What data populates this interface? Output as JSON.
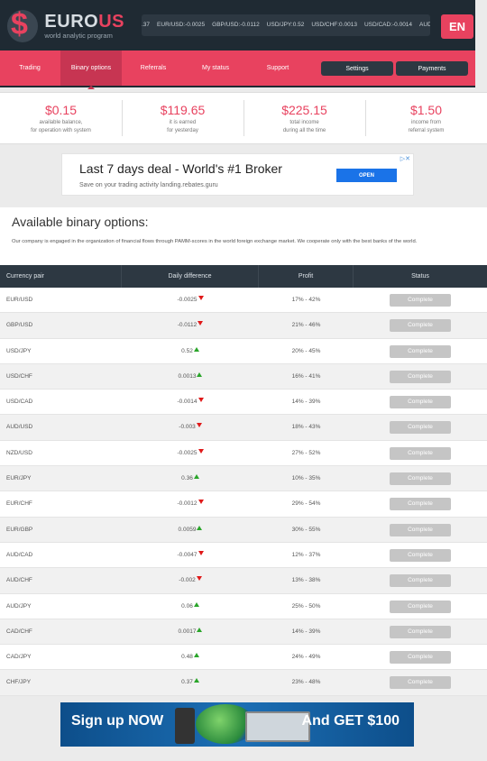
{
  "header": {
    "brand_a": "EURO",
    "brand_b": "US",
    "tagline": "world analytic program",
    "logo_glyph": "$",
    "ticker": [
      ".37",
      "EUR/USD:-0.0025",
      "GBP/USD:-0.0112",
      "USD/JPY:0.52",
      "USD/CHF:0.0013",
      "USD/CAD:-0.0014",
      "AUD/USD:-0"
    ],
    "lang": "EN"
  },
  "nav": {
    "items": [
      "Trading",
      "Binary options",
      "Referrals",
      "My status",
      "Support"
    ],
    "active": "Binary options",
    "settings": "Settings",
    "payments": "Payments"
  },
  "stats": [
    {
      "value": "$0.15",
      "l1": "available balance,",
      "l2": "for operation with system"
    },
    {
      "value": "$119.65",
      "l1": "it is earned",
      "l2": "for yesterday"
    },
    {
      "value": "$225.15",
      "l1": "total income",
      "l2": "during all the time"
    },
    {
      "value": "$1.50",
      "l1": "income from",
      "l2": "referral system"
    }
  ],
  "ad": {
    "title": "Last 7 days deal - World's #1 Broker",
    "sub": "Save on your trading activity landing.rebates.guru",
    "open": "OPEN"
  },
  "panel": {
    "title": "Available binary options:",
    "desc": "Our company is engaged in the organization of financial flows through PAMM-scores in the world foreign exchange market. We cooperate only with the best banks of the world."
  },
  "table": {
    "headers": [
      "Currency pair",
      "Daily difference",
      "Profit",
      "Status"
    ],
    "rows": [
      {
        "pair": "EUR/USD",
        "diff": "-0.0025",
        "dir": "down",
        "profit": "17% - 42%",
        "status": "Complete"
      },
      {
        "pair": "GBP/USD",
        "diff": "-0.0112",
        "dir": "down",
        "profit": "21% - 46%",
        "status": "Complete"
      },
      {
        "pair": "USD/JPY",
        "diff": "0.52",
        "dir": "up",
        "profit": "20% - 45%",
        "status": "Complete"
      },
      {
        "pair": "USD/CHF",
        "diff": "0.0013",
        "dir": "up",
        "profit": "16% - 41%",
        "status": "Complete"
      },
      {
        "pair": "USD/CAD",
        "diff": "-0.0014",
        "dir": "down",
        "profit": "14% - 39%",
        "status": "Complete"
      },
      {
        "pair": "AUD/USD",
        "diff": "-0.003",
        "dir": "down",
        "profit": "18% - 43%",
        "status": "Complete"
      },
      {
        "pair": "NZD/USD",
        "diff": "-0.0025",
        "dir": "down",
        "profit": "27% - 52%",
        "status": "Complete"
      },
      {
        "pair": "EUR/JPY",
        "diff": "0.36",
        "dir": "up",
        "profit": "10% - 35%",
        "status": "Complete"
      },
      {
        "pair": "EUR/CHF",
        "diff": "-0.0012",
        "dir": "down",
        "profit": "29% - 54%",
        "status": "Complete"
      },
      {
        "pair": "EUR/GBP",
        "diff": "0.0059",
        "dir": "up",
        "profit": "30% - 55%",
        "status": "Complete"
      },
      {
        "pair": "AUD/CAD",
        "diff": "-0.0047",
        "dir": "down",
        "profit": "12% - 37%",
        "status": "Complete"
      },
      {
        "pair": "AUD/CHF",
        "diff": "-0.002",
        "dir": "down",
        "profit": "13% - 38%",
        "status": "Complete"
      },
      {
        "pair": "AUD/JPY",
        "diff": "0.06",
        "dir": "up",
        "profit": "25% - 50%",
        "status": "Complete"
      },
      {
        "pair": "CAD/CHF",
        "diff": "0.0017",
        "dir": "up",
        "profit": "14% - 39%",
        "status": "Complete"
      },
      {
        "pair": "CAD/JPY",
        "diff": "0.48",
        "dir": "up",
        "profit": "24% - 49%",
        "status": "Complete"
      },
      {
        "pair": "CHF/JPY",
        "diff": "0.37",
        "dir": "up",
        "profit": "23% - 48%",
        "status": "Complete"
      }
    ]
  },
  "banner": {
    "left": "Sign up NOW",
    "right": "And GET $100"
  },
  "colors": {
    "accent": "#e8425f",
    "dark": "#1f2a33",
    "up": "#2aa52a",
    "down": "#e01919"
  }
}
